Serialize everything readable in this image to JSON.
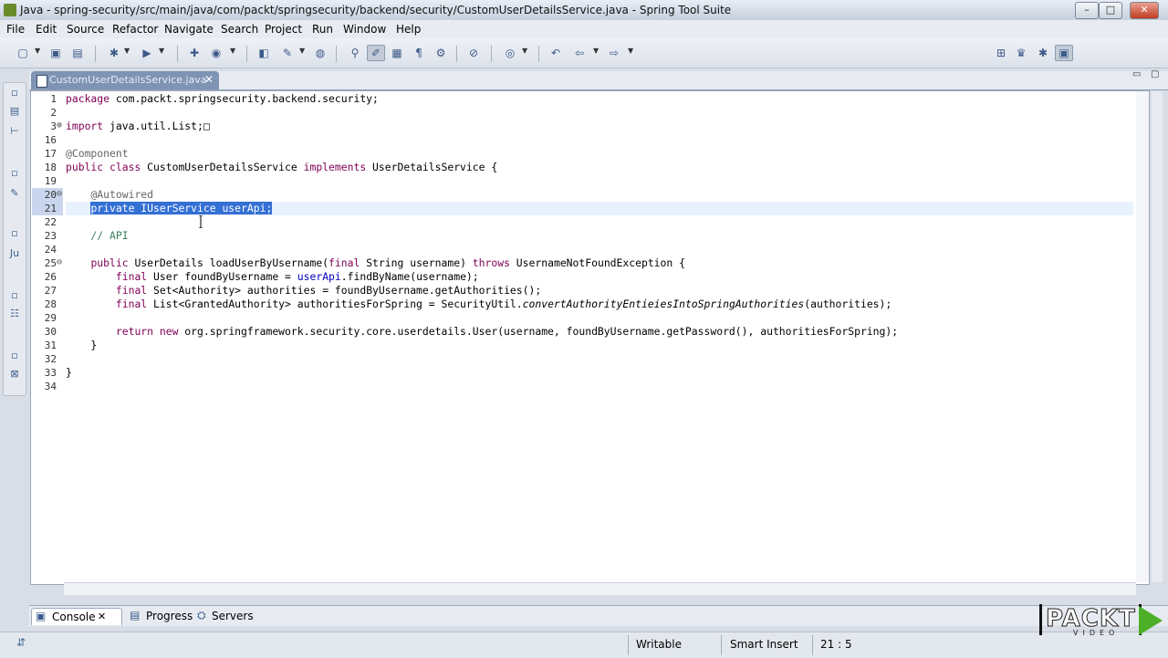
{
  "window": {
    "title": "Java - spring-security/src/main/java/com/packt/springsecurity/backend/security/CustomUserDetailsService.java - Spring Tool Suite",
    "minimize": "–",
    "maximize": "□",
    "close": "✕"
  },
  "menu": [
    "File",
    "Edit",
    "Source",
    "Refactor",
    "Navigate",
    "Search",
    "Project",
    "Run",
    "Window",
    "Help"
  ],
  "editor": {
    "tab_label": "CustomUserDetailsService.java",
    "tab_close": "✕",
    "lines": [
      {
        "num": "1",
        "fold": "",
        "segments": [
          {
            "t": "package",
            "c": "kw"
          },
          {
            "t": " com.packt.springsecurity.backend.security;",
            "c": ""
          }
        ]
      },
      {
        "num": "2",
        "fold": "",
        "segments": []
      },
      {
        "num": "3",
        "fold": "⊕",
        "segments": [
          {
            "t": "import",
            "c": "kw"
          },
          {
            "t": " java.util.List;",
            "c": ""
          },
          {
            "t": "□",
            "c": ""
          }
        ]
      },
      {
        "num": "16",
        "fold": "",
        "segments": []
      },
      {
        "num": "17",
        "fold": "",
        "segments": [
          {
            "t": "@Component",
            "c": "ann"
          }
        ]
      },
      {
        "num": "18",
        "fold": "",
        "segments": [
          {
            "t": "public class",
            "c": "kw"
          },
          {
            "t": " CustomUserDetailsService ",
            "c": ""
          },
          {
            "t": "implements",
            "c": "kw"
          },
          {
            "t": " UserDetailsService {",
            "c": ""
          }
        ]
      },
      {
        "num": "19",
        "fold": "",
        "segments": []
      },
      {
        "num": "20",
        "fold": "⊖",
        "segments": [
          {
            "t": "    ",
            "c": ""
          },
          {
            "t": "@Autowired",
            "c": "ann"
          }
        ]
      },
      {
        "num": "21",
        "fold": "",
        "segments": [
          {
            "t": "    ",
            "c": ""
          },
          {
            "t": "private IUserService userApi;",
            "c": "sel"
          }
        ]
      },
      {
        "num": "22",
        "fold": "",
        "segments": []
      },
      {
        "num": "23",
        "fold": "",
        "segments": [
          {
            "t": "    // API",
            "c": "cm"
          }
        ]
      },
      {
        "num": "24",
        "fold": "",
        "segments": []
      },
      {
        "num": "25",
        "fold": "⊖",
        "segments": [
          {
            "t": "    ",
            "c": ""
          },
          {
            "t": "public",
            "c": "kw"
          },
          {
            "t": " UserDetails loadUserByUsername(",
            "c": ""
          },
          {
            "t": "final",
            "c": "kw"
          },
          {
            "t": " String username) ",
            "c": ""
          },
          {
            "t": "throws",
            "c": "kw"
          },
          {
            "t": " UsernameNotFoundException {",
            "c": ""
          }
        ]
      },
      {
        "num": "26",
        "fold": "",
        "segments": [
          {
            "t": "        ",
            "c": ""
          },
          {
            "t": "final",
            "c": "kw"
          },
          {
            "t": " User foundByUsername = ",
            "c": ""
          },
          {
            "t": "userApi",
            "c": "fld"
          },
          {
            "t": ".findByName(username);",
            "c": ""
          }
        ]
      },
      {
        "num": "27",
        "fold": "",
        "segments": [
          {
            "t": "        ",
            "c": ""
          },
          {
            "t": "final",
            "c": "kw"
          },
          {
            "t": " Set<Authority> authorities = foundByUsername.getAuthorities();",
            "c": ""
          }
        ]
      },
      {
        "num": "28",
        "fold": "",
        "segments": [
          {
            "t": "        ",
            "c": ""
          },
          {
            "t": "final",
            "c": "kw"
          },
          {
            "t": " List<GrantedAuthority> authoritiesForSpring = SecurityUtil.",
            "c": ""
          },
          {
            "t": "convertAuthorityEntieiesIntoSpringAuthorities",
            "c": "it"
          },
          {
            "t": "(authorities);",
            "c": ""
          }
        ]
      },
      {
        "num": "29",
        "fold": "",
        "segments": []
      },
      {
        "num": "30",
        "fold": "",
        "segments": [
          {
            "t": "        ",
            "c": ""
          },
          {
            "t": "return new",
            "c": "kw"
          },
          {
            "t": " org.springframework.security.core.userdetails.User(username, foundByUsername.getPassword(), authoritiesForSpring);",
            "c": ""
          }
        ]
      },
      {
        "num": "31",
        "fold": "",
        "segments": [
          {
            "t": "    }",
            "c": ""
          }
        ]
      },
      {
        "num": "32",
        "fold": "",
        "segments": []
      },
      {
        "num": "33",
        "fold": "",
        "segments": [
          {
            "t": "}",
            "c": ""
          }
        ]
      },
      {
        "num": "34",
        "fold": "",
        "segments": []
      }
    ]
  },
  "bottom_tabs": [
    {
      "label": "Console",
      "close": "✕"
    },
    {
      "label": "Progress"
    },
    {
      "label": "Servers"
    }
  ],
  "status": {
    "mode": "Writable",
    "insert": "Smart Insert",
    "position": "21 : 5"
  },
  "logo": {
    "word": "PACKT",
    "sub": "VIDEO"
  },
  "colors": {
    "keyword": "#7f0055",
    "annotation": "#646464",
    "comment": "#3f7f5f",
    "field": "#0000c0",
    "selection": "#3470d4"
  }
}
